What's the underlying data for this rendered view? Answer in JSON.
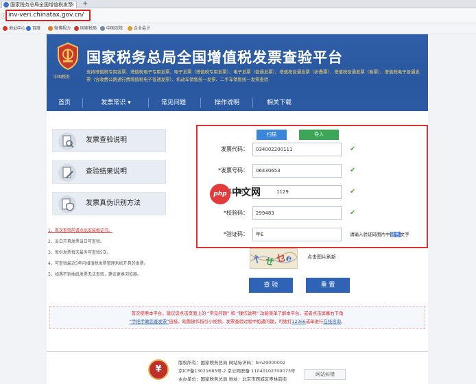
{
  "browser": {
    "tab_title": "国家税务总局全国增值税发票",
    "new_tab_symbol": "+",
    "close_symbol": "×",
    "address": "inv-veri.chinatax.gov.cn/",
    "bookmarks": [
      {
        "label": "地址中心",
        "color": "#d9342b"
      },
      {
        "label": "百度",
        "color": "#2f6bd6"
      },
      {
        "label": "微博视力",
        "color": "#e0782a"
      },
      {
        "label": "国家税局",
        "color": "#c7392f"
      },
      {
        "label": "中国法院",
        "color": "#7a8796"
      },
      {
        "label": "企业会计",
        "color": "#d9a12b"
      }
    ]
  },
  "banner": {
    "title": "国家税务总局全国增值税发票查验平台",
    "emblem_caption": "中国税务",
    "description": "支持增值税专用发票、增值税电子专用发票、电子发票（增值税专用发票）、电子发票（普通发票）、增值税普通发票（折叠票）、增值税普通发票（卷票）、增值税电子普通发票（含收费公路通行费增值税电子普通发票）、机动车销售统一发票、二手车销售统一发票查验"
  },
  "nav": {
    "items": [
      "首页",
      "发票常识",
      "常见问题",
      "操作说明",
      "相关下载"
    ],
    "dropdown_marker": "▾"
  },
  "left": {
    "buttons": [
      "发票查验说明",
      "查验结果说明",
      "发票真伪识别方法"
    ],
    "notes": [
      "1、首次查验前请点此安装根证书。",
      "2、当日开具发票当日可查验。",
      "3、每份发票每天最多可查验5次。",
      "4、可查验最近5年内增值税发票管理系统开具的发票。",
      "5、如遇不到插纸发票无法查验，建议更换浏览器。"
    ]
  },
  "form": {
    "tabs": [
      "扫描",
      "导入"
    ],
    "fields": [
      {
        "label": "发票代码：",
        "value": "034002200111"
      },
      {
        "label": "*发票号码：",
        "value": "06430653"
      },
      {
        "label": "*开票日期：",
        "value": "1129"
      },
      {
        "label": "*校验码：",
        "value": "299483"
      },
      {
        "label": "*验证码：",
        "value": "年E"
      }
    ],
    "check_glyph": "✔",
    "captcha_hint_prefix": "请输入验证码图片中",
    "captcha_hint_color": "蓝色",
    "captcha_hint_suffix": "文字",
    "captcha_refresh": "点击图片刷新",
    "submit": "查 验",
    "reset": "重 置"
  },
  "watermark": {
    "badge": "php",
    "text": "中文网"
  },
  "notice": {
    "line1": "首次使用本平台，建议您点击页面上的 “常见问题” 和 “操作说明” 功能菜单了解本平台，或者点击屏幕右下角",
    "link": "“手把手教您查发票”",
    "line2": "链接，观看操作指引小视频。发票查验过程中如遇问题，可拨打",
    "phone": "12366",
    "line2b": "或单进行",
    "online": "在线咨询",
    "line2c": "。"
  },
  "footer": {
    "logo_glyph": "¥",
    "line1": "版权所有：国家税务总局   网站标识码：bm29000002",
    "line2": "京ICP备13021685号-2   京公网安备 11040102700073号",
    "line3": "主办单位：国家税务总局   地址：北京市西城区枣林前街",
    "badge": "网站纠错"
  }
}
